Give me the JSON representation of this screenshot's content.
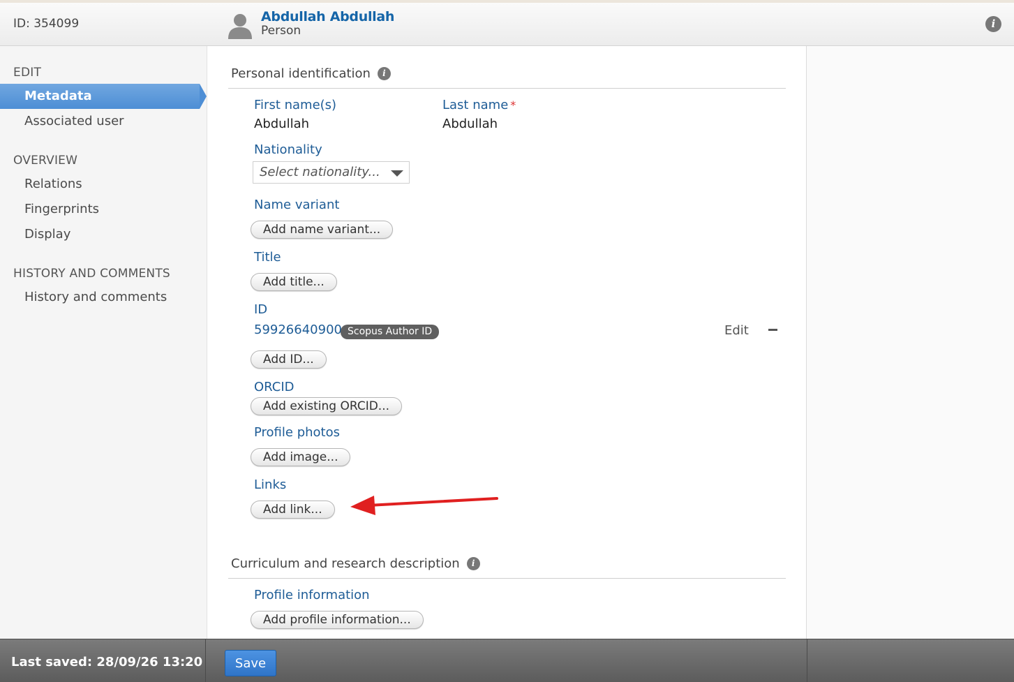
{
  "header": {
    "record_id": "ID: 354099",
    "person_name": "Abdullah Abdullah",
    "person_type": "Person"
  },
  "sidebar": {
    "edit_heading": "EDIT",
    "edit_items": [
      "Metadata",
      "Associated user"
    ],
    "overview_heading": "OVERVIEW",
    "overview_items": [
      "Relations",
      "Fingerprints",
      "Display"
    ],
    "history_heading": "HISTORY AND COMMENTS",
    "history_items": [
      "History and comments"
    ],
    "active_item": "Metadata"
  },
  "personal": {
    "section_title": "Personal identification",
    "first_name_label": "First name(s)",
    "first_name_value": "Abdullah",
    "last_name_label": "Last name",
    "required_mark": "*",
    "last_name_value": "Abdullah",
    "nationality_label": "Nationality",
    "nationality_placeholder": "Select nationality...",
    "name_variant_label": "Name variant",
    "name_variant_button": "Add name variant...",
    "title_label": "Title",
    "title_button": "Add title...",
    "id_label": "ID",
    "id_value": "59926640900",
    "id_type_badge": "Scopus Author ID",
    "edit_label": "Edit",
    "add_id_button": "Add ID...",
    "orcid_label": "ORCID",
    "orcid_button": "Add existing ORCID...",
    "photos_label": "Profile photos",
    "photos_button": "Add image...",
    "links_label": "Links",
    "links_button": "Add link..."
  },
  "curriculum": {
    "section_title": "Curriculum and research description",
    "profile_info_label": "Profile information",
    "profile_info_button": "Add profile information..."
  },
  "footer": {
    "last_saved": "Last saved: 28/09/26 13:20",
    "save_button": "Save"
  },
  "colors": {
    "accent_blue": "#4d8ed5",
    "label_blue": "#1e5c96",
    "annotation_red": "#e02020"
  }
}
